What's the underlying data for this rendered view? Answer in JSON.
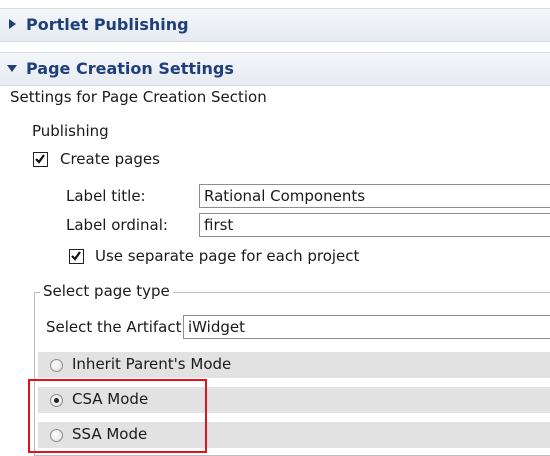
{
  "sections": {
    "portlet_publishing": {
      "title": "Portlet Publishing",
      "expanded": false
    },
    "page_creation": {
      "title": "Page Creation Settings",
      "expanded": true,
      "description": "Settings for Page Creation Section"
    }
  },
  "publishing": {
    "label": "Publishing",
    "create_pages": {
      "label": "Create pages",
      "checked": true
    },
    "label_title": {
      "label": "Label title:",
      "value": "Rational Components"
    },
    "label_ordinal": {
      "label": "Label ordinal:",
      "value": "first"
    },
    "separate_page": {
      "label": "Use separate page for each project",
      "checked": true
    }
  },
  "page_type": {
    "group_label": "Select page type",
    "artifact_label": "Select the Artifact",
    "artifact_value": "iWidget",
    "modes": [
      {
        "label": "Inherit Parent's Mode",
        "selected": false
      },
      {
        "label": "CSA Mode",
        "selected": true
      },
      {
        "label": "SSA Mode",
        "selected": false
      }
    ]
  },
  "colors": {
    "header_text": "#1f3f7a",
    "highlight": "#e0141e",
    "radio_row_bg": "#e2e2e2"
  },
  "icons": {
    "collapsed": "triangle-right-icon",
    "expanded": "triangle-down-icon",
    "check": "checkmark-icon"
  }
}
